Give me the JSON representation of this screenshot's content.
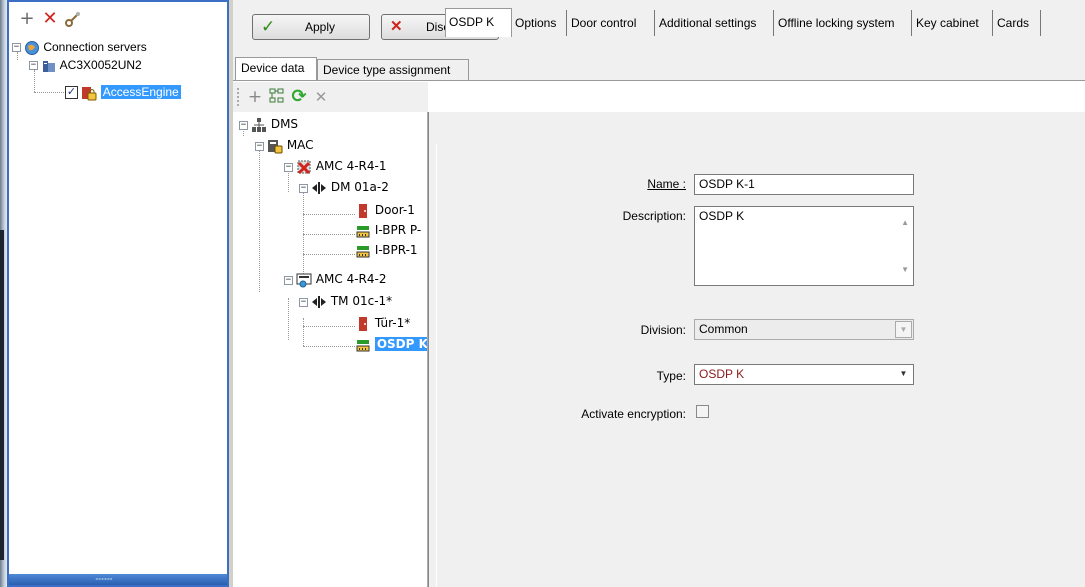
{
  "left_toolbar": {
    "add_icon": "plus-icon",
    "delete_icon": "x-icon",
    "connect_icon": "key-icon"
  },
  "left_tree": {
    "root": "Connection servers",
    "server": "AC3X0052UN2",
    "engine": "AccessEngine"
  },
  "toolbar": {
    "apply_label": "Apply",
    "discard_label": "Discard"
  },
  "main_tabs": [
    "Device data",
    "Device type assignment"
  ],
  "device_toolbar": {
    "add_icon": "plus-icon",
    "tree_icon": "hierarchy-icon",
    "refresh_icon": "refresh-icon",
    "delete_icon": "x-icon"
  },
  "device_tree": {
    "dms": "DMS",
    "mac": "MAC",
    "amc1": "AMC 4-R4-1",
    "dm01a": "DM 01a-2",
    "door1": "Door-1",
    "ibpr_p": "I-BPR P-",
    "ibpr1": "I-BPR-1",
    "amc2": "AMC 4-R4-2",
    "tm01c": "TM 01c-1*",
    "tur1": "Tür-1*",
    "osdp": "OSDP K"
  },
  "property_tabs": [
    "OSDP K",
    "Options",
    "Door control",
    "Additional settings",
    "Offline locking system",
    "Key cabinet",
    "Cards"
  ],
  "form": {
    "name_label": "Name :",
    "name_value": "OSDP K-1",
    "description_label": "Description:",
    "description_value": "OSDP K",
    "division_label": "Division:",
    "division_value": "Common",
    "type_label": "Type:",
    "type_value": "OSDP K",
    "encryption_label": "Activate encryption:"
  },
  "colors": {
    "selection": "#3399ff",
    "type_text": "#8b1a1a",
    "panel_border": "#3c6ec6"
  }
}
